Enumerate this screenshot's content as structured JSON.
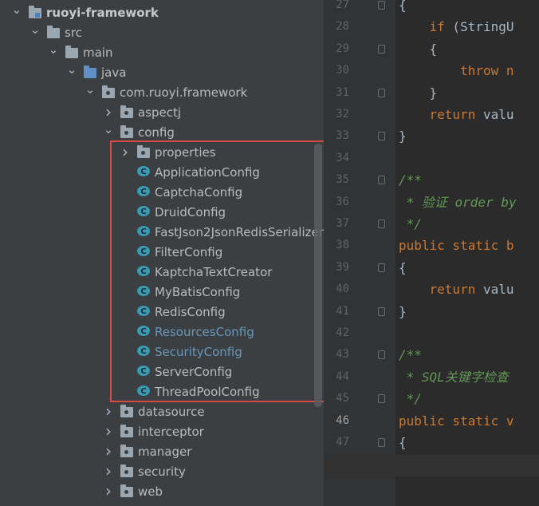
{
  "tree": {
    "items": [
      {
        "label": "ruoyi-framework",
        "depth": 0,
        "icon": "module-folder-icon",
        "expanded": true,
        "bold": true
      },
      {
        "label": "src",
        "depth": 1,
        "icon": "folder-icon",
        "expanded": true
      },
      {
        "label": "main",
        "depth": 2,
        "icon": "folder-icon",
        "expanded": true
      },
      {
        "label": "java",
        "depth": 3,
        "icon": "source-folder-icon",
        "expanded": true
      },
      {
        "label": "com.ruoyi.framework",
        "depth": 4,
        "icon": "package-icon",
        "expanded": true
      },
      {
        "label": "aspectj",
        "depth": 5,
        "icon": "package-icon",
        "expanded": false
      },
      {
        "label": "config",
        "depth": 5,
        "icon": "package-icon",
        "expanded": true
      },
      {
        "label": "properties",
        "depth": 6,
        "icon": "package-icon",
        "expanded": false
      },
      {
        "label": "ApplicationConfig",
        "depth": 6,
        "icon": "class-icon"
      },
      {
        "label": "CaptchaConfig",
        "depth": 6,
        "icon": "class-icon"
      },
      {
        "label": "DruidConfig",
        "depth": 6,
        "icon": "class-icon"
      },
      {
        "label": "FastJson2JsonRedisSerializer",
        "depth": 6,
        "icon": "class-icon"
      },
      {
        "label": "FilterConfig",
        "depth": 6,
        "icon": "class-icon"
      },
      {
        "label": "KaptchaTextCreator",
        "depth": 6,
        "icon": "class-icon"
      },
      {
        "label": "MyBatisConfig",
        "depth": 6,
        "icon": "class-icon"
      },
      {
        "label": "RedisConfig",
        "depth": 6,
        "icon": "class-icon"
      },
      {
        "label": "ResourcesConfig",
        "depth": 6,
        "icon": "class-icon",
        "vcs": true
      },
      {
        "label": "SecurityConfig",
        "depth": 6,
        "icon": "class-icon",
        "vcs": true
      },
      {
        "label": "ServerConfig",
        "depth": 6,
        "icon": "class-icon"
      },
      {
        "label": "ThreadPoolConfig",
        "depth": 6,
        "icon": "class-icon"
      },
      {
        "label": "datasource",
        "depth": 5,
        "icon": "package-icon",
        "expanded": false
      },
      {
        "label": "interceptor",
        "depth": 5,
        "icon": "package-icon",
        "expanded": false
      },
      {
        "label": "manager",
        "depth": 5,
        "icon": "package-icon",
        "expanded": false
      },
      {
        "label": "security",
        "depth": 5,
        "icon": "package-icon",
        "expanded": false
      },
      {
        "label": "web",
        "depth": 5,
        "icon": "package-icon",
        "expanded": false
      }
    ]
  },
  "editor": {
    "lines": [
      {
        "num": "27",
        "fold": true,
        "segments": [
          {
            "t": "{",
            "c": "pl"
          }
        ]
      },
      {
        "num": "28",
        "segments": [
          {
            "t": "    ",
            "c": "pl"
          },
          {
            "t": "if",
            "c": "kw"
          },
          {
            "t": " (StringU",
            "c": "pl"
          }
        ]
      },
      {
        "num": "29",
        "fold": true,
        "segments": [
          {
            "t": "    {",
            "c": "pl"
          }
        ]
      },
      {
        "num": "30",
        "segments": [
          {
            "t": "        ",
            "c": "pl"
          },
          {
            "t": "throw n",
            "c": "kw"
          }
        ]
      },
      {
        "num": "31",
        "fold": true,
        "segments": [
          {
            "t": "    }",
            "c": "pl"
          }
        ]
      },
      {
        "num": "32",
        "segments": [
          {
            "t": "    ",
            "c": "pl"
          },
          {
            "t": "return",
            "c": "kw"
          },
          {
            "t": " valu",
            "c": "pl"
          }
        ]
      },
      {
        "num": "33",
        "fold": true,
        "segments": [
          {
            "t": "}",
            "c": "pl"
          }
        ]
      },
      {
        "num": "34",
        "segments": []
      },
      {
        "num": "35",
        "fold": true,
        "segments": [
          {
            "t": "/**",
            "c": "cm"
          }
        ]
      },
      {
        "num": "36",
        "segments": [
          {
            "t": " * 验证 order by",
            "c": "cm"
          }
        ]
      },
      {
        "num": "37",
        "fold": true,
        "segments": [
          {
            "t": " */",
            "c": "cm"
          }
        ]
      },
      {
        "num": "38",
        "segments": [
          {
            "t": "public static b",
            "c": "kw"
          }
        ]
      },
      {
        "num": "39",
        "fold": true,
        "segments": [
          {
            "t": "{",
            "c": "pl"
          }
        ]
      },
      {
        "num": "40",
        "segments": [
          {
            "t": "    ",
            "c": "pl"
          },
          {
            "t": "return",
            "c": "kw"
          },
          {
            "t": " valu",
            "c": "pl"
          }
        ]
      },
      {
        "num": "41",
        "fold": true,
        "segments": [
          {
            "t": "}",
            "c": "pl"
          }
        ]
      },
      {
        "num": "42",
        "segments": []
      },
      {
        "num": "43",
        "fold": true,
        "segments": [
          {
            "t": "/**",
            "c": "cm"
          }
        ]
      },
      {
        "num": "44",
        "segments": [
          {
            "t": " * SQL关键字检查",
            "c": "cm"
          }
        ]
      },
      {
        "num": "45",
        "fold": true,
        "segments": [
          {
            "t": " */",
            "c": "cm"
          }
        ]
      },
      {
        "num": "46",
        "current": true,
        "segments": [
          {
            "t": "public static v",
            "c": "kw"
          }
        ]
      },
      {
        "num": "47",
        "fold": true,
        "segments": [
          {
            "t": "{",
            "c": "pl"
          }
        ]
      }
    ]
  }
}
